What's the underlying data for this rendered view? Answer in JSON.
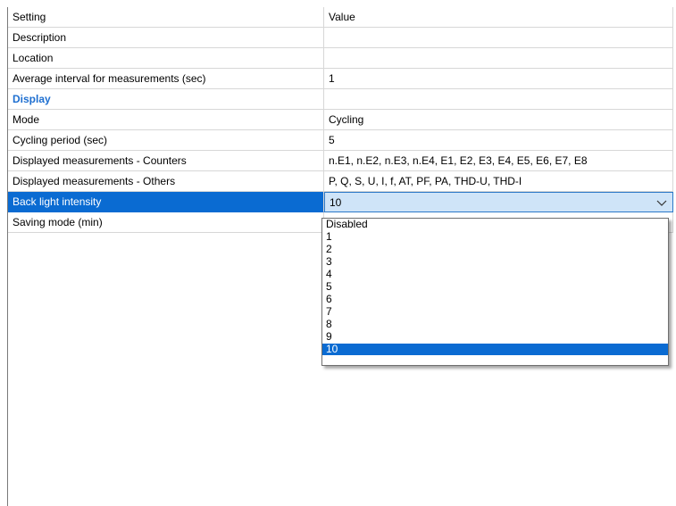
{
  "header": {
    "setting": "Setting",
    "value": "Value"
  },
  "rows": [
    {
      "setting": "Description",
      "value": ""
    },
    {
      "setting": "Location",
      "value": ""
    },
    {
      "setting": "Average interval for measurements (sec)",
      "value": "1"
    },
    {
      "setting": "Display",
      "value": ""
    },
    {
      "setting": "Mode",
      "value": "Cycling"
    },
    {
      "setting": "Cycling period (sec)",
      "value": "5"
    },
    {
      "setting": "Displayed measurements - Counters",
      "value": "n.E1, n.E2, n.E3, n.E4, E1, E2, E3, E4, E5, E6, E7, E8"
    },
    {
      "setting": "Displayed measurements - Others",
      "value": "P, Q, S, U, I, f, AT, PF, PA, THD-U, THD-I"
    },
    {
      "setting": "Back light intensity",
      "value": "10"
    },
    {
      "setting": "Saving mode (min)",
      "value": ""
    }
  ],
  "dropdown": {
    "options": [
      "Disabled",
      "1",
      "2",
      "3",
      "4",
      "5",
      "6",
      "7",
      "8",
      "9",
      "10"
    ],
    "selected": "10"
  },
  "colors": {
    "selection": "#0a6bd2",
    "section_header": "#1e6fd0",
    "value_highlight": "#cfe4f8"
  },
  "icons": {
    "dropdown_arrow": "chevron-down-icon"
  }
}
